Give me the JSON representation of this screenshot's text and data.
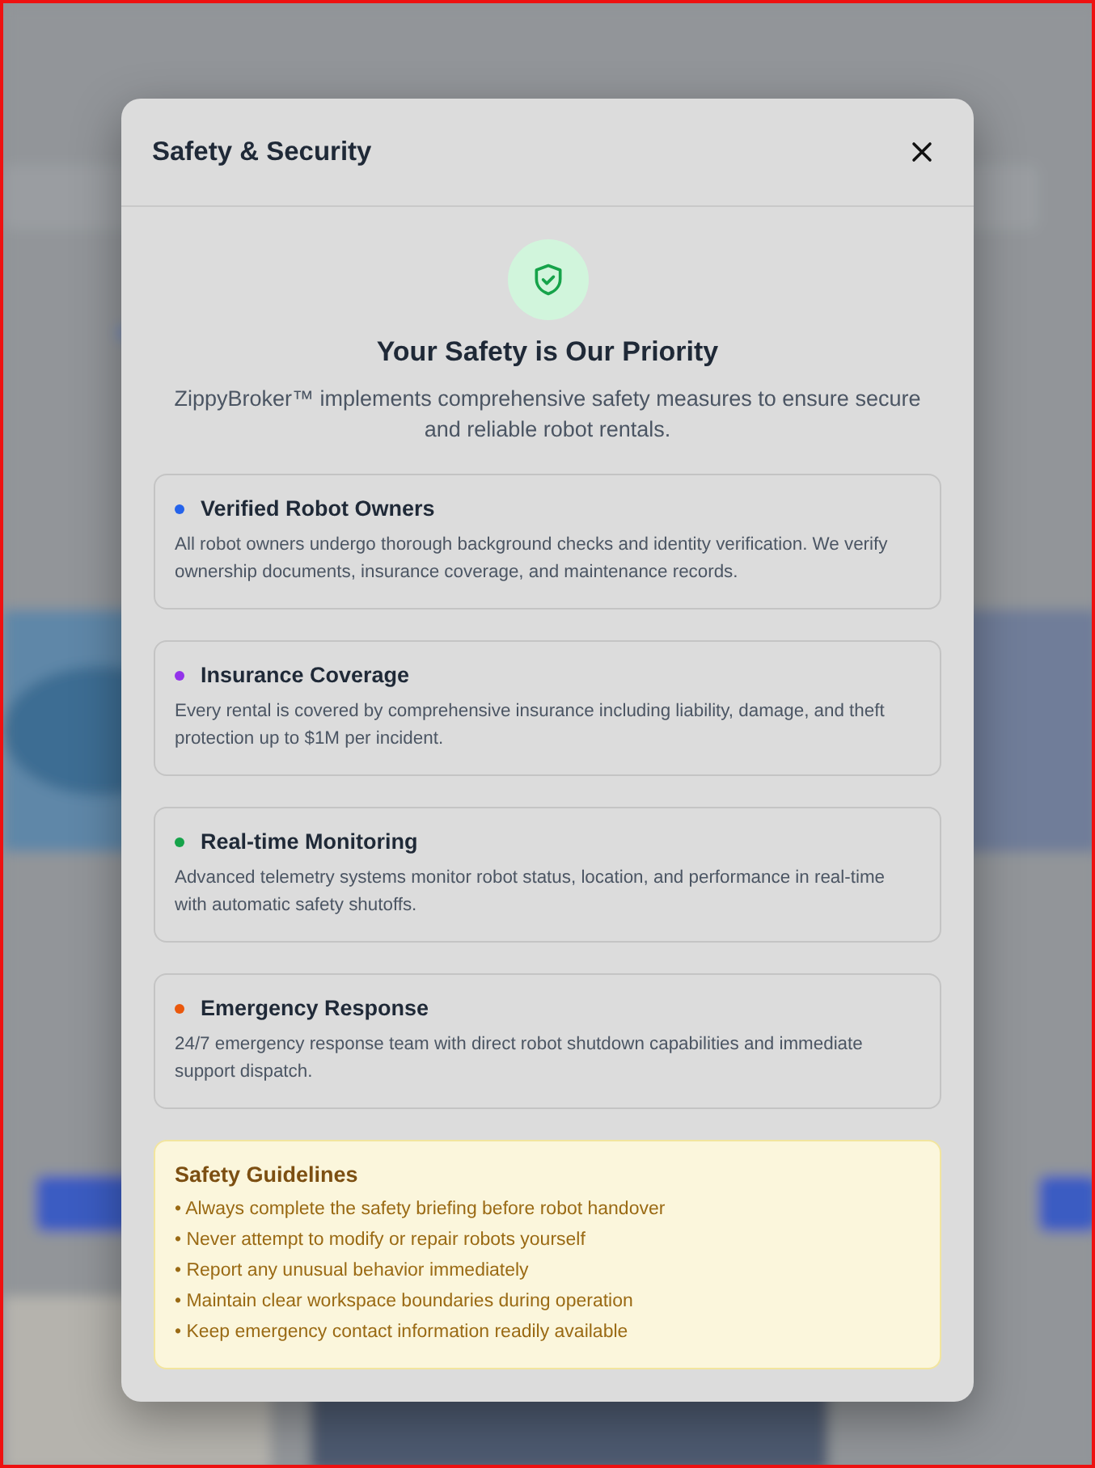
{
  "dialog": {
    "title": "Safety & Security",
    "heading": "Your Safety is Our Priority",
    "intro": "ZippyBroker™ implements comprehensive safety measures to ensure secure and reliable robot rentals.",
    "features": [
      {
        "title": "Verified Robot Owners",
        "color": "#2563eb",
        "text": "All robot owners undergo thorough background checks and identity verification. We verify ownership documents, insurance coverage, and maintenance records."
      },
      {
        "title": "Insurance Coverage",
        "color": "#9333ea",
        "text": "Every rental is covered by comprehensive insurance including liability, damage, and theft protection up to $1M per incident."
      },
      {
        "title": "Real-time Monitoring",
        "color": "#16a34a",
        "text": "Advanced telemetry systems monitor robot status, location, and performance in real-time with automatic safety shutoffs."
      },
      {
        "title": "Emergency Response",
        "color": "#ea580c",
        "text": "24/7 emergency response team with direct robot shutdown capabilities and immediate support dispatch."
      }
    ],
    "guidelines": {
      "title": "Safety Guidelines",
      "items": [
        "• Always complete the safety briefing before robot handover",
        "• Never attempt to modify or repair robots yourself",
        "• Report any unusual behavior immediately",
        "• Maintain clear workspace boundaries during operation",
        "• Keep emergency contact information readily available"
      ]
    }
  }
}
